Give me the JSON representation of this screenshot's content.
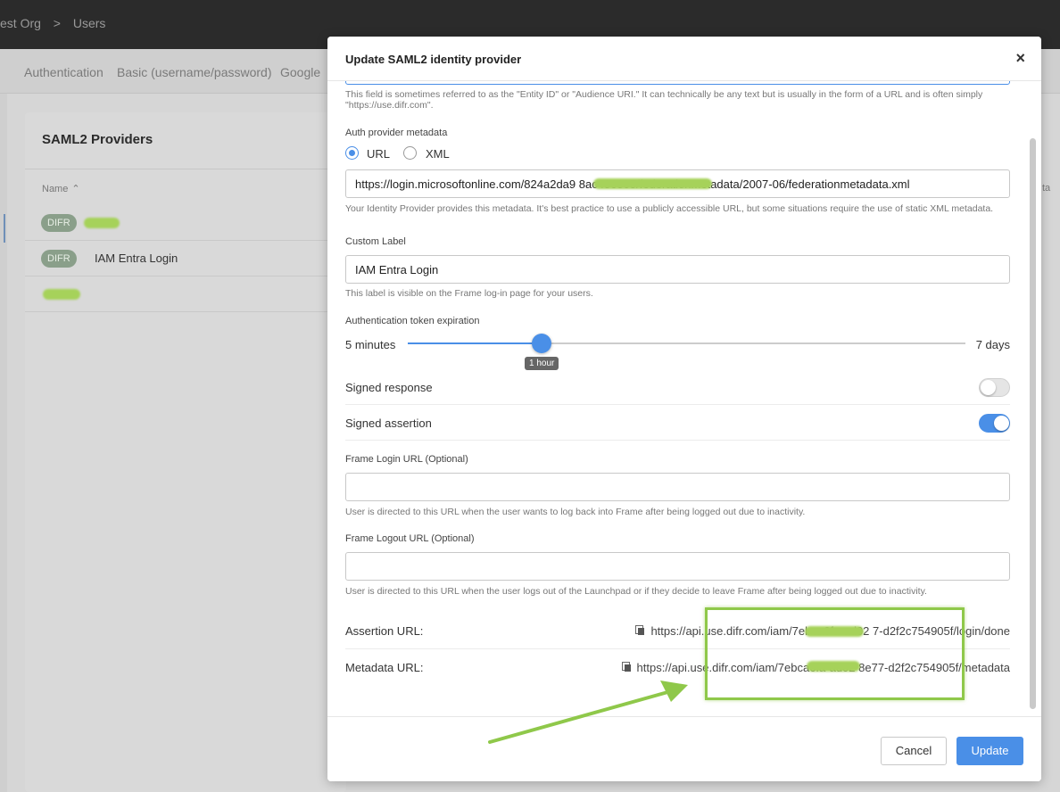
{
  "breadcrumb": {
    "org": "est Org",
    "sep": ">",
    "page": "Users"
  },
  "subnav": {
    "items": [
      "Authentication",
      "Basic (username/password)",
      "Google"
    ]
  },
  "providers_card": {
    "title": "SAML2 Providers",
    "column_name": "Name",
    "rows": [
      {
        "badge": "DIFR",
        "name": ""
      },
      {
        "badge": "DIFR",
        "name": "IAM Entra Login"
      },
      {
        "badge": "",
        "name": ""
      }
    ],
    "right_column_fragment": "ta"
  },
  "modal": {
    "title": "Update SAML2 identity provider",
    "close": "×",
    "entity_help": "This field is sometimes referred to as the \"Entity ID\" or \"Audience URI.\" It can technically be any text but is usually in the form of a URL and is often simply \"https://use.difr.com\".",
    "metadata": {
      "label": "Auth provider metadata",
      "option_url": "URL",
      "option_xml": "XML",
      "selected": "URL",
      "value": "https://login.microsoftonline.com/824a2da9                  8ac486805/federationmetadata/2007-06/federationmetadata.xml",
      "help": "Your Identity Provider provides this metadata. It's best practice to use a publicly accessible URL, but some situations require the use of static XML metadata."
    },
    "custom_label": {
      "label": "Custom Label",
      "value": "IAM Entra Login",
      "help": "This label is visible on the Frame log-in page for your users."
    },
    "token_expiration": {
      "label": "Authentication token expiration",
      "min_label": "5 minutes",
      "max_label": "7 days",
      "value_label": "1 hour",
      "fraction": 0.24
    },
    "signed_response": {
      "label": "Signed response",
      "on": false
    },
    "signed_assertion": {
      "label": "Signed assertion",
      "on": true
    },
    "frame_login_url": {
      "label": "Frame Login URL (Optional)",
      "value": "",
      "help": "User is directed to this URL when the user wants to log back into Frame after being logged out due to inactivity."
    },
    "frame_logout_url": {
      "label": "Frame Logout URL (Optional)",
      "value": "",
      "help": "User is directed to this URL when the user logs out of the Launchpad or if they decide to leave Frame after being logged out due to inactivity."
    },
    "assertion_url": {
      "label": "Assertion URL:",
      "value": "https://api.use.difr.com/iam/7ebca6fa-ad02          7-d2f2c754905f/login/done"
    },
    "metadata_url": {
      "label": "Metadata URL:",
      "value": "https://api.use.difr.com/iam/7ebca6fa-ad02         8e77-d2f2c754905f/metadata"
    },
    "cancel": "Cancel",
    "update": "Update"
  },
  "colors": {
    "accent": "#4a8fe7",
    "annotation": "#8fc84a"
  }
}
